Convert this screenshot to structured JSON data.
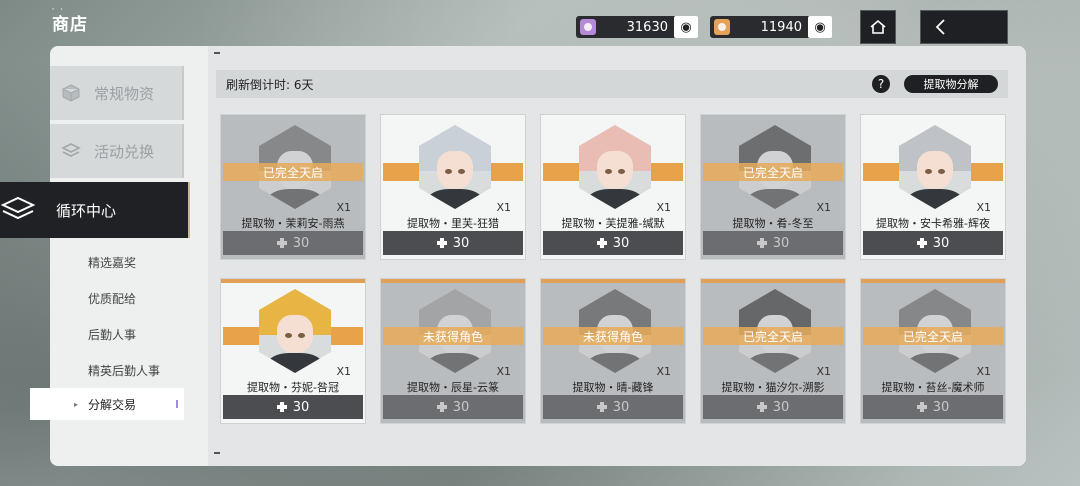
{
  "header": {
    "logo_text": "商店",
    "currency_a": {
      "value": "31630",
      "color": "#b58ad8"
    },
    "currency_b": {
      "value": "11940",
      "color": "#e7a259"
    }
  },
  "sidebar": {
    "categories": [
      {
        "label": "常规物资"
      },
      {
        "label": "活动兑换"
      },
      {
        "label": "循环中心"
      }
    ],
    "subitems": [
      {
        "label": "精选嘉奖"
      },
      {
        "label": "优质配给"
      },
      {
        "label": "后勤人事"
      },
      {
        "label": "精英后勤人事"
      },
      {
        "label": "分解交易"
      }
    ]
  },
  "content": {
    "refresh_text": "刷新倒计时:  6天",
    "help_label": "?",
    "decompose_label": "提取物分解",
    "items": [
      {
        "name": "提取物・茉莉安-雨燕",
        "qty": "X1",
        "price": "30",
        "status": "已完全天启",
        "hair": "#6b5a4f",
        "dim": true
      },
      {
        "name": "提取物・里芙-狂猎",
        "qty": "X1",
        "price": "30",
        "status": "",
        "hair": "#c9d0d8",
        "dim": false
      },
      {
        "name": "提取物・芙提雅-缄默",
        "qty": "X1",
        "price": "30",
        "status": "",
        "hair": "#e9bdb4",
        "dim": false
      },
      {
        "name": "提取物・肴-冬至",
        "qty": "X1",
        "price": "30",
        "status": "已完全天启",
        "hair": "#2d2f33",
        "dim": true
      },
      {
        "name": "提取物・安卡希雅-辉夜",
        "qty": "X1",
        "price": "30",
        "status": "",
        "hair": "#bfc2c6",
        "dim": false
      },
      {
        "name": "提取物・芬妮-咎冠",
        "qty": "X1",
        "price": "30",
        "status": "",
        "hair": "#e8b545",
        "dim": false
      },
      {
        "name": "提取物・辰星-云篆",
        "qty": "X1",
        "price": "30",
        "status": "未获得角色",
        "hair": "#8d9197",
        "dim": true
      },
      {
        "name": "提取物・晴-藏锋",
        "qty": "X1",
        "price": "30",
        "status": "未获得角色",
        "hair": "#5a3d33",
        "dim": true
      },
      {
        "name": "提取物・猫汐尔-溯影",
        "qty": "X1",
        "price": "30",
        "status": "已完全天启",
        "hair": "#1f2124",
        "dim": true
      },
      {
        "name": "提取物・苔丝-魔术师",
        "qty": "X1",
        "price": "30",
        "status": "已完全天启",
        "hair": "#a8483a",
        "dim": true
      }
    ]
  }
}
